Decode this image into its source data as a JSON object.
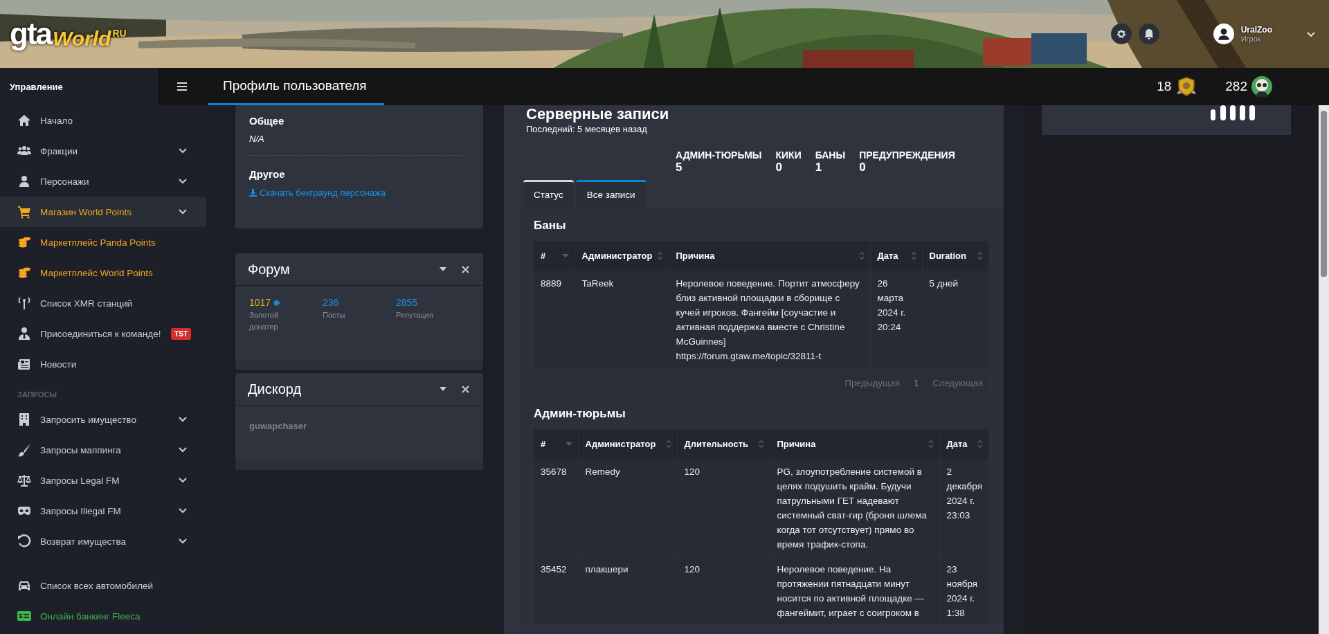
{
  "header": {
    "logo": {
      "part_1": "gta",
      "part_2": "World",
      "part_3": "RU"
    },
    "user_name": "UralZoo",
    "user_role": "Игрок"
  },
  "navbar": {
    "sidebar_title": "Управление",
    "title": "Профиль пользователя",
    "counters": [
      {
        "value": "18"
      },
      {
        "value": "282"
      }
    ]
  },
  "sidebar": {
    "groups": [
      {
        "items": [
          {
            "label": "Начало",
            "expandable": false,
            "selected": false,
            "color": "#c9cdd4"
          },
          {
            "label": "Фракции",
            "expandable": true,
            "selected": false,
            "color": "#c9cdd4"
          },
          {
            "label": "Персонажи",
            "expandable": true,
            "selected": false,
            "color": "#c9cdd4"
          },
          {
            "label": "Магазин World Points",
            "expandable": true,
            "selected": true,
            "color": "#f5a623"
          },
          {
            "label": "Маркетплейс Panda Points",
            "expandable": false,
            "selected": false,
            "color": "#f5a623"
          },
          {
            "label": "Маркетплейс World Points",
            "expandable": false,
            "selected": false,
            "color": "#f5a623"
          },
          {
            "label": "Список XMR станций",
            "expandable": false,
            "selected": false,
            "color": "#c9cdd4"
          },
          {
            "label": "Присоединиться к команде!",
            "expandable": false,
            "selected": false,
            "color": "#c9cdd4",
            "badge": "TST"
          },
          {
            "label": "Новости",
            "expandable": false,
            "selected": false,
            "color": "#c9cdd4"
          }
        ]
      },
      {
        "heading": "ЗАПРОСЫ",
        "items": [
          {
            "label": "Запросить имущество",
            "expandable": true,
            "selected": false,
            "color": "#c9cdd4"
          },
          {
            "label": "Запросы маппинга",
            "expandable": true,
            "selected": false,
            "color": "#c9cdd4"
          },
          {
            "label": "Запросы Legal FM",
            "expandable": true,
            "selected": false,
            "color": "#c9cdd4"
          },
          {
            "label": "Запросы Illegal FM",
            "expandable": true,
            "selected": false,
            "color": "#c9cdd4"
          },
          {
            "label": "Возврат имущества",
            "expandable": true,
            "selected": false,
            "color": "#c9cdd4"
          }
        ]
      },
      {
        "items": [
          {
            "label": "Список всех автомобилей",
            "expandable": false,
            "selected": false,
            "color": "#c9cdd4"
          },
          {
            "label": "Онлайн банкинг Fleeca",
            "expandable": false,
            "selected": false,
            "color": "#3cb44b"
          }
        ]
      }
    ]
  },
  "profile_card": {
    "sections": [
      {
        "heading": "Общее",
        "value": "N/A"
      },
      {
        "heading": "Другое",
        "link": "Скачать бекграунд персонажа"
      }
    ]
  },
  "forum_card": {
    "title": "Форум",
    "stats": [
      {
        "kind": "donor",
        "value": "1017",
        "label": "Золотой донатер"
      },
      {
        "kind": "plain",
        "value": "236",
        "label": "Посты"
      },
      {
        "kind": "plain",
        "value": "2855",
        "label": "Репутация"
      }
    ]
  },
  "discord_card": {
    "title": "Дискорд",
    "value": "guwapchaser"
  },
  "records": {
    "title": "Серверные записи",
    "subtitle": "Последний: 5 месяцев назад",
    "stats": [
      {
        "label": "АДМИН-ТЮРЬМЫ",
        "value": "5"
      },
      {
        "label": "КИКИ",
        "value": "0"
      },
      {
        "label": "БАНЫ",
        "value": "1"
      },
      {
        "label": "ПРЕДУПРЕЖДЕНИЯ",
        "value": "0"
      }
    ],
    "tabs": [
      {
        "label": "Статус",
        "selected": false
      },
      {
        "label": "Все записи",
        "selected": true
      }
    ],
    "bans": {
      "heading": "Баны",
      "columns": [
        {
          "label": "#",
          "sorted": true
        },
        {
          "label": "Администратор",
          "sorted": false
        },
        {
          "label": "Причина",
          "sorted": false
        },
        {
          "label": "Дата",
          "sorted": false
        },
        {
          "label": "Duration",
          "sorted": false
        }
      ],
      "rows": [
        [
          "8889",
          "TaReek",
          "Неролевое поведение. Портит атмосферу близ активной площадки в сборище с кучей игроков. Фангейм [соучастие и активная поддержка вместе с Christine McGuinnes] https://forum.gtaw.me/topic/32811-t",
          "26 марта 2024 г. 20:24",
          "5 дней"
        ]
      ],
      "pagination": {
        "previous": {
          "label": "Предыдущая",
          "disabled": true
        },
        "page": "1",
        "next": {
          "label": "Следующая",
          "disabled": true
        }
      }
    },
    "jails": {
      "heading": "Админ-тюрьмы",
      "columns": [
        {
          "label": "#",
          "sorted": true
        },
        {
          "label": "Администратор",
          "sorted": false
        },
        {
          "label": "Длительность",
          "sorted": false
        },
        {
          "label": "Причина",
          "sorted": false
        },
        {
          "label": "Дата",
          "sorted": false
        }
      ],
      "rows": [
        [
          "35678",
          "Remedy",
          "120",
          "PG, злоупотребление системой в целях подушить крайм. Будучи патрульными ГЕТ надевают системный сват-гир (броня шлема когда тот отсутствует) прямо во время трафик-стопа.",
          "2 декабря 2024 г. 23:03"
        ],
        [
          "35452",
          "плакшери",
          "120",
          "Неролевое поведение. На протяжении пятнадцати минут носится по активной площадке — фангеймит, играет с соигроком в",
          "23 ноября 2024 г. 1:38"
        ]
      ]
    }
  }
}
